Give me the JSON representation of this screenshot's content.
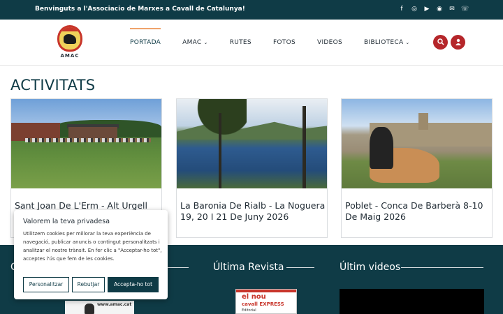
{
  "topbar": {
    "welcome": "Benvinguts a l'Associacio de Marxes a Cavall de Catalunya!",
    "social": [
      "facebook-icon",
      "instagram-icon",
      "youtube-icon",
      "whatsapp-icon",
      "email-icon",
      "phone-icon"
    ]
  },
  "logo": {
    "text": "AMAC"
  },
  "nav": {
    "items": [
      {
        "label": "PORTADA",
        "active": true
      },
      {
        "label": "AMAC",
        "dropdown": true
      },
      {
        "label": "RUTES"
      },
      {
        "label": "FOTOS"
      },
      {
        "label": "VIDEOS"
      },
      {
        "label": "BIBLIOTECA",
        "dropdown": true
      }
    ]
  },
  "section": {
    "title": "ACTIVITATS"
  },
  "cards": [
    {
      "caption": "Sant Joan De L'Erm - Alt Urgell"
    },
    {
      "caption": "La Baronia De Rialb - La Noguera 19, 20 I 21 De Juny 2026"
    },
    {
      "caption": "Poblet - Conca De Barberà 8-10 De Maig 2026"
    }
  ],
  "footer": {
    "col1_heading": "C",
    "revista_heading": "Última Revista",
    "videos_heading": "Últim videos",
    "amac_url": "www.amac.cat",
    "revista_title_1": "el nou",
    "revista_title_2": "cavall",
    "revista_title_3": "EXPRESS",
    "revista_editorial": "Editorial"
  },
  "cookie": {
    "title": "Valorem la teva privadesa",
    "text": "Utilitzem cookies per millorar la teva experiència de navegació, publicar anuncis o contingut personalitzats i analitzar el nostre trànsit. En fer clic a \"Acceptar-ho tot\", acceptes l'ús que fem de les cookies.",
    "btn_customize": "Personalitzar",
    "btn_reject": "Rebutjar",
    "btn_accept": "Accepta-ho tot"
  },
  "colors": {
    "primary": "#0f3b46",
    "accent": "#b5262a",
    "nav_indicator": "#f0a36c"
  }
}
